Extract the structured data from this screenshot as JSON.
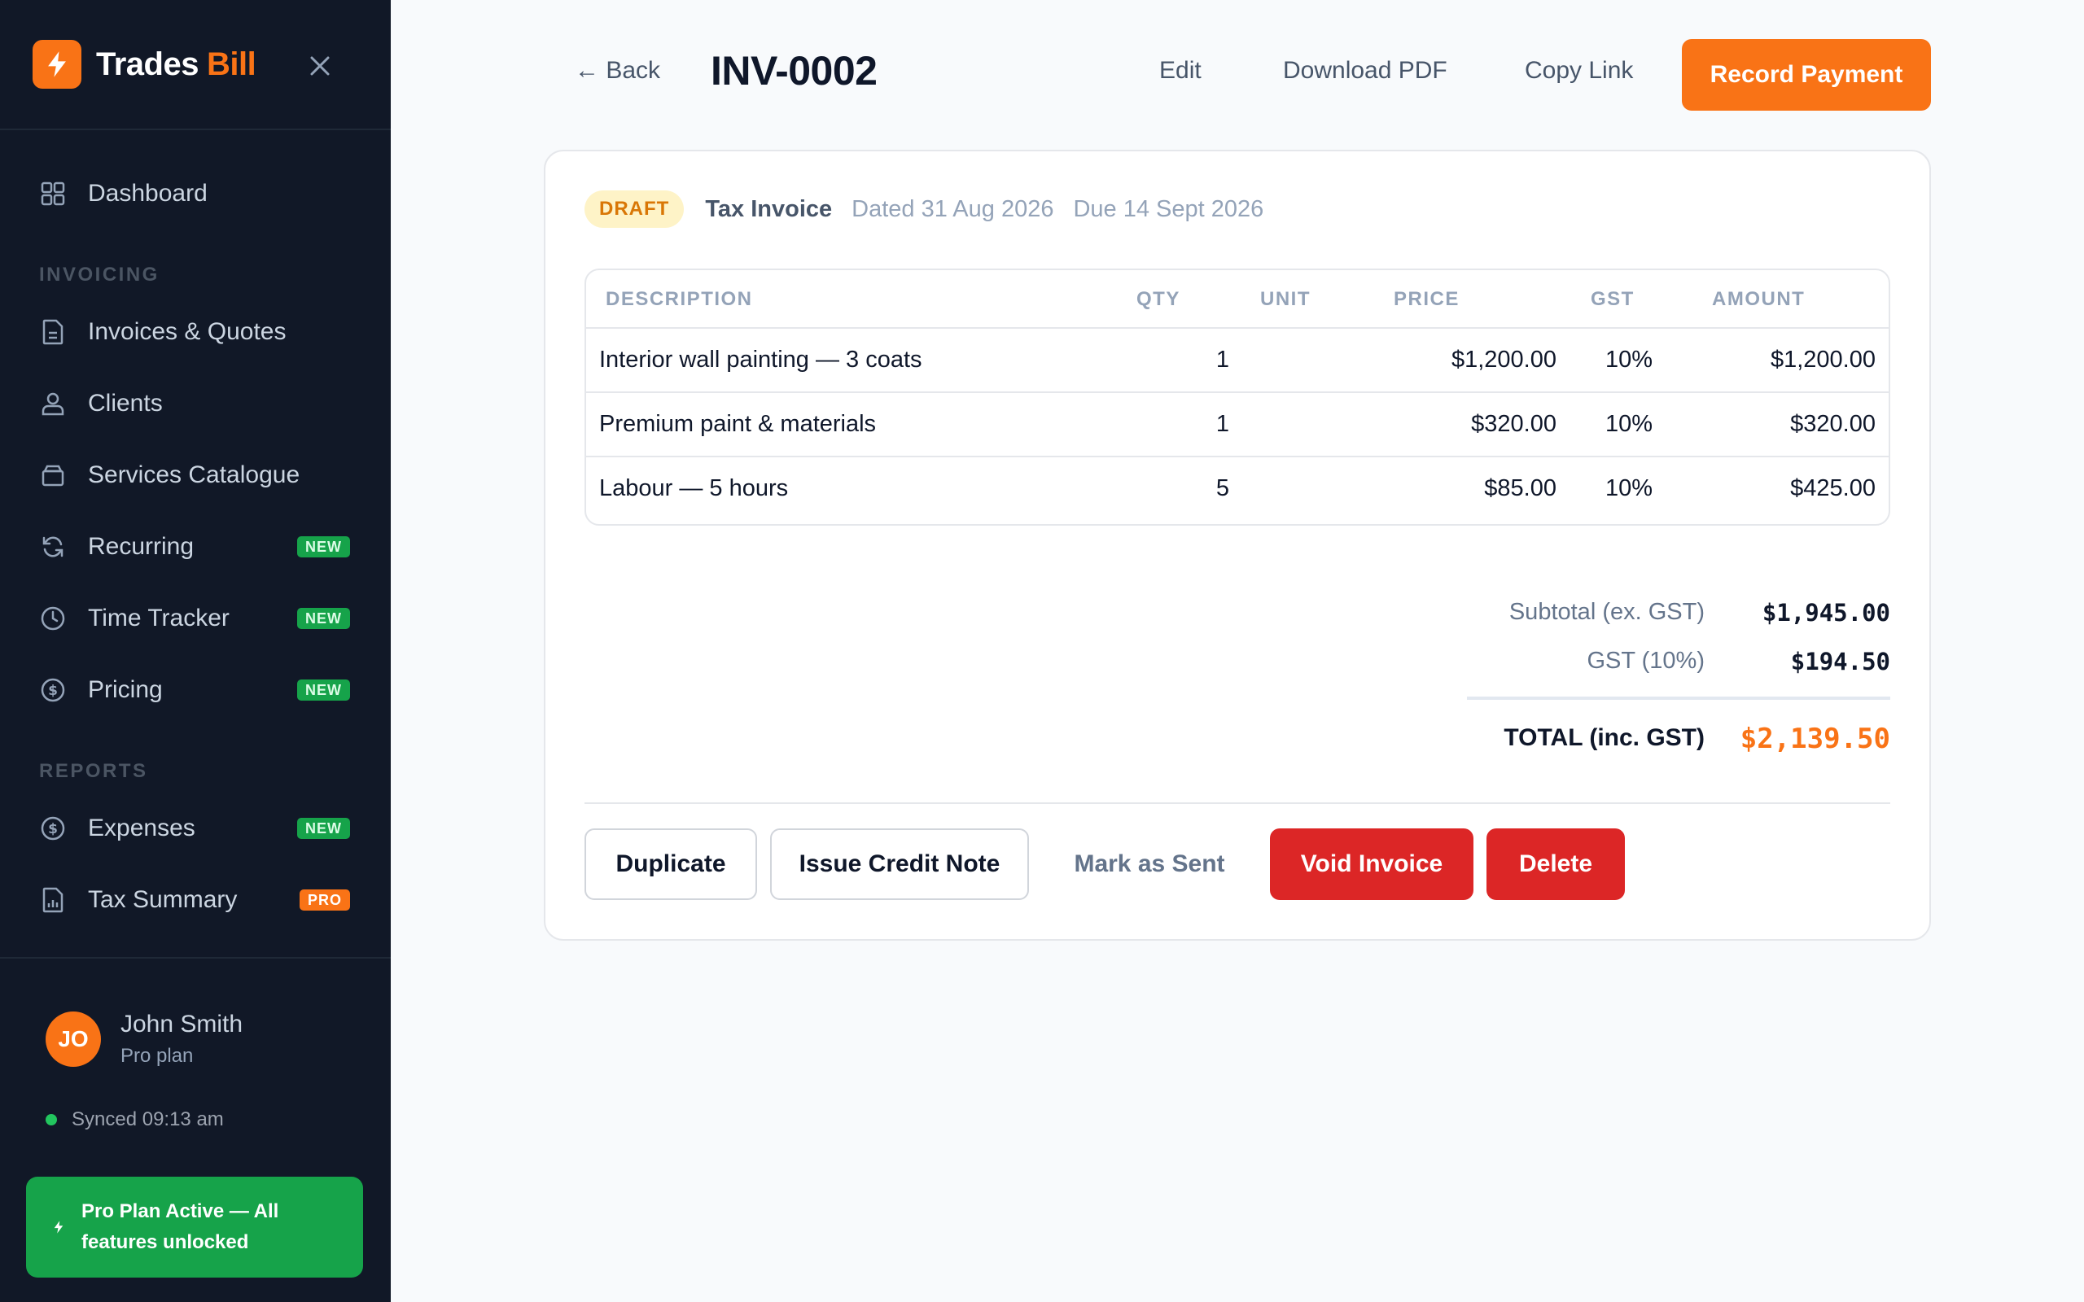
{
  "brand": {
    "name": "Trades",
    "accent": "Bill"
  },
  "sidebar": {
    "items": [
      {
        "label": "Dashboard",
        "icon": "grid-icon"
      },
      {
        "label": "Invoices & Quotes",
        "icon": "document-icon"
      },
      {
        "label": "Clients",
        "icon": "users-icon"
      },
      {
        "label": "Services Catalogue",
        "icon": "box-icon"
      },
      {
        "label": "Recurring",
        "icon": "refresh-icon",
        "badge": "NEW"
      },
      {
        "label": "Time Tracker",
        "icon": "clock-icon",
        "badge": "NEW"
      },
      {
        "label": "Pricing",
        "icon": "dollar-icon",
        "badge": "NEW"
      },
      {
        "label": "Expenses",
        "icon": "dollar-icon",
        "badge": "NEW"
      },
      {
        "label": "Tax Summary",
        "icon": "report-icon",
        "badge": "PRO"
      }
    ],
    "sections": {
      "invoicing": "INVOICING",
      "reports": "REPORTS"
    }
  },
  "user": {
    "initials": "JO",
    "name": "John Smith",
    "plan": "Pro plan"
  },
  "sync": {
    "text": "Synced 09:13 am"
  },
  "pro_banner": {
    "line1": "Pro Plan Active — All",
    "line2": "features unlocked"
  },
  "header": {
    "back": "← Back",
    "invoice_number": "INV-0002",
    "edit": "Edit",
    "download": "Download PDF",
    "copy": "Copy Link",
    "record": "Record Payment"
  },
  "invoice": {
    "status": "DRAFT",
    "type": "Tax Invoice",
    "dated": "Dated 31 Aug 2026",
    "due": "Due 14 Sept 2026",
    "columns": [
      "DESCRIPTION",
      "QTY",
      "UNIT",
      "PRICE",
      "GST",
      "AMOUNT"
    ],
    "rows": [
      {
        "description": "Interior wall painting — 3 coats",
        "qty": "1",
        "unit": "",
        "price": "$1,200.00",
        "gst": "10%",
        "amount": "$1,200.00"
      },
      {
        "description": "Premium paint & materials",
        "qty": "1",
        "unit": "",
        "price": "$320.00",
        "gst": "10%",
        "amount": "$320.00"
      },
      {
        "description": "Labour — 5 hours",
        "qty": "5",
        "unit": "",
        "price": "$85.00",
        "gst": "10%",
        "amount": "$425.00"
      }
    ],
    "subtotal_label": "Subtotal (ex. GST)",
    "subtotal": "$1,945.00",
    "gst_label": "GST (10%)",
    "gst": "$194.50",
    "total_label": "TOTAL (inc. GST)",
    "total": "$2,139.50"
  },
  "actions": {
    "duplicate": "Duplicate",
    "credit_note": "Issue Credit Note",
    "mark_sent": "Mark as Sent",
    "void": "Void Invoice",
    "delete": "Delete"
  },
  "colors": {
    "accent": "#f97316",
    "sidebar": "#111827",
    "success": "#16a34a",
    "danger": "#dc2626"
  }
}
